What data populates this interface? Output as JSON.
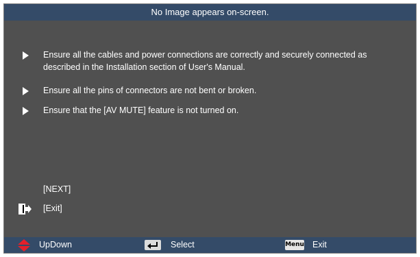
{
  "title": "No Image appears on-screen.",
  "tips": [
    {
      "text": "Ensure all the cables and power connections are correctly and securely connected as described in the Installation section of User's Manual."
    },
    {
      "text": "Ensure all the pins of connectors are not bent or broken."
    },
    {
      "text": "Ensure that the [AV MUTE] feature is not turned on."
    }
  ],
  "next_label": "[NEXT]",
  "exit_label": "[Exit]",
  "footer": {
    "updown_label": "UpDown",
    "select_label": "Select",
    "menu_key": "Menu",
    "exit_label": "Exit"
  },
  "colors": {
    "panel_bg": "#505050",
    "bar_bg": "#344b68",
    "updown_icon": "#e5202a"
  },
  "icons": {
    "bullet": "arrow-right-icon",
    "exit": "exit-door-icon",
    "updown": "up-down-arrows-icon",
    "select": "enter-key-icon",
    "menu": "menu-key-icon"
  }
}
